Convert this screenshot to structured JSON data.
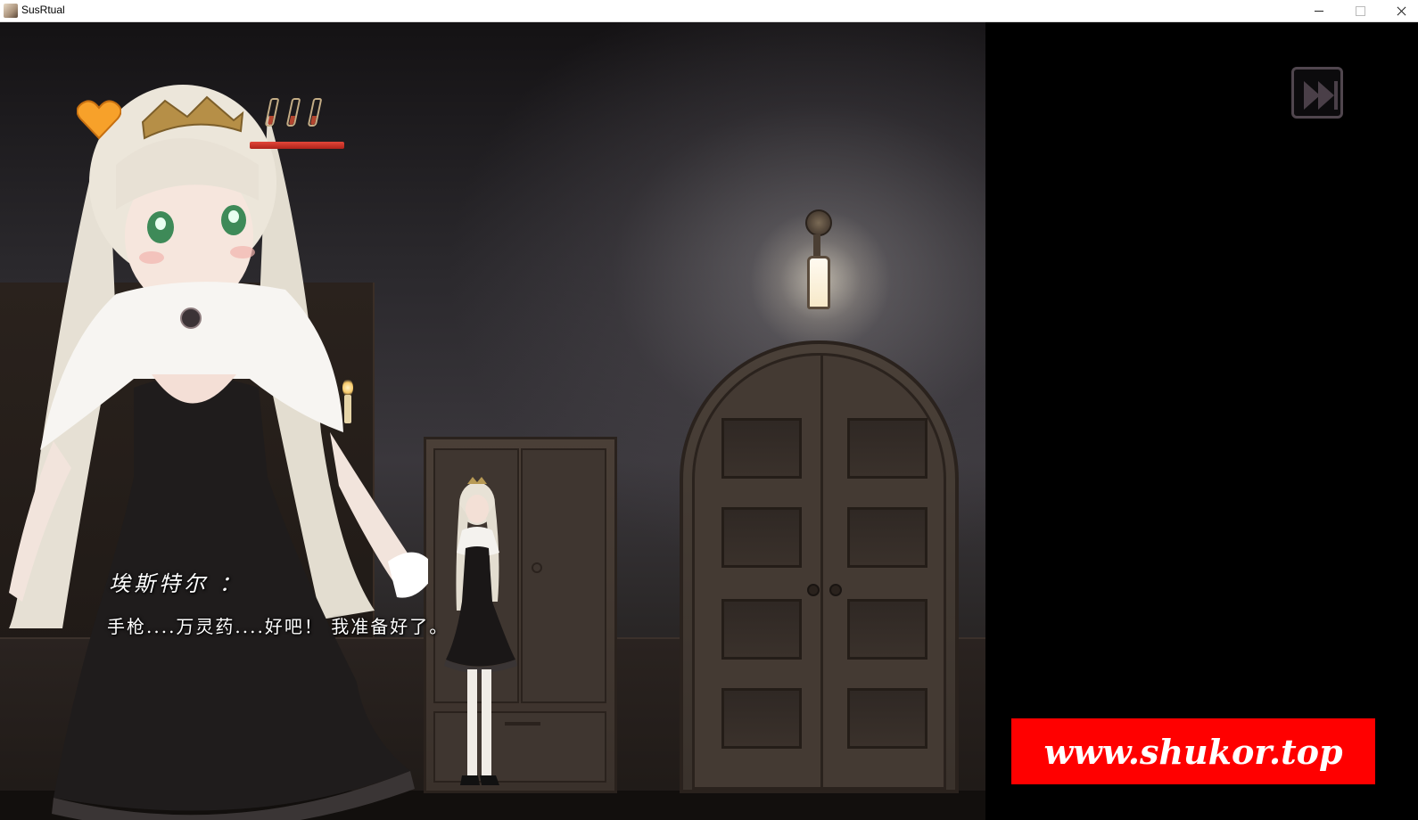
{
  "window": {
    "title": "SusRtual",
    "controls": {
      "minimize": "minimize",
      "maximize": "maximize",
      "close": "close"
    }
  },
  "hud": {
    "heart_icon": "heart-icon",
    "vials": [
      "potion-vial-icon",
      "potion-vial-icon",
      "potion-vial-icon"
    ],
    "hp_fraction": 1.0,
    "colors": {
      "heart": "#f7a12a",
      "hp": "#d8362b",
      "vial_liquid": "#b3452f"
    }
  },
  "controls": {
    "skip_icon": "fast-forward-icon"
  },
  "dialogue": {
    "speaker": "埃斯特尔 ：",
    "text": "手枪....万灵药....好吧！ 我准备好了。"
  },
  "watermark": {
    "text": "www.shukor.top",
    "color": "#ff0000"
  }
}
